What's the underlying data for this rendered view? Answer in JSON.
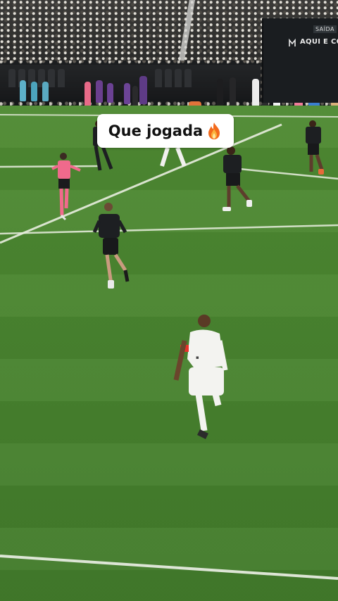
{
  "caption": {
    "text": "Que jogada",
    "emoji_icon": "fire-icon"
  },
  "stadium": {
    "exit_sign": "SAÍDA",
    "ad_board_text": "AQUI E COR"
  },
  "colors": {
    "pitch": "#4a8530",
    "referee_shirt": "#f06a8c",
    "dark_kit": "#1d1f22",
    "white_kit": "#f3f3f0",
    "captain_armband": "#e8322a"
  }
}
